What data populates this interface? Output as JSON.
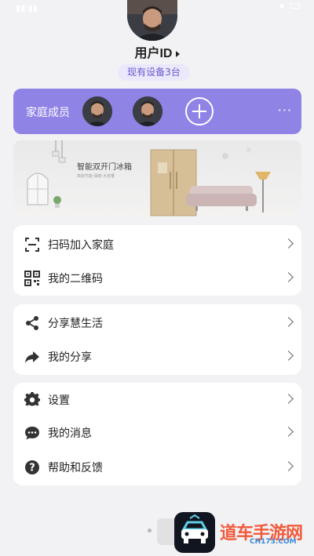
{
  "header": {
    "user_id": "用户ID",
    "device_badge": "现有设备3台"
  },
  "family": {
    "label": "家庭成员",
    "more": "···"
  },
  "banner": {
    "title": "智能双开门冰箱",
    "subtitle": "高效节能 保鲜 大容量"
  },
  "groups": [
    {
      "items": [
        {
          "label": "扫码加入家庭",
          "icon": "scan-icon"
        },
        {
          "label": "我的二维码",
          "icon": "qr-code-icon"
        }
      ]
    },
    {
      "items": [
        {
          "label": "分享慧生活",
          "icon": "share-icon"
        },
        {
          "label": "我的分享",
          "icon": "forward-arrow-icon"
        }
      ]
    },
    {
      "items": [
        {
          "label": "设置",
          "icon": "gear-icon"
        },
        {
          "label": "我的消息",
          "icon": "message-icon"
        },
        {
          "label": "帮助和反馈",
          "icon": "help-icon"
        }
      ]
    }
  ],
  "watermark": {
    "text": "道车手游网",
    "url": "CH173.COM"
  },
  "colors": {
    "accent": "#8f83e6",
    "badge_text": "#6659cf",
    "background": "#f2f2f4"
  }
}
